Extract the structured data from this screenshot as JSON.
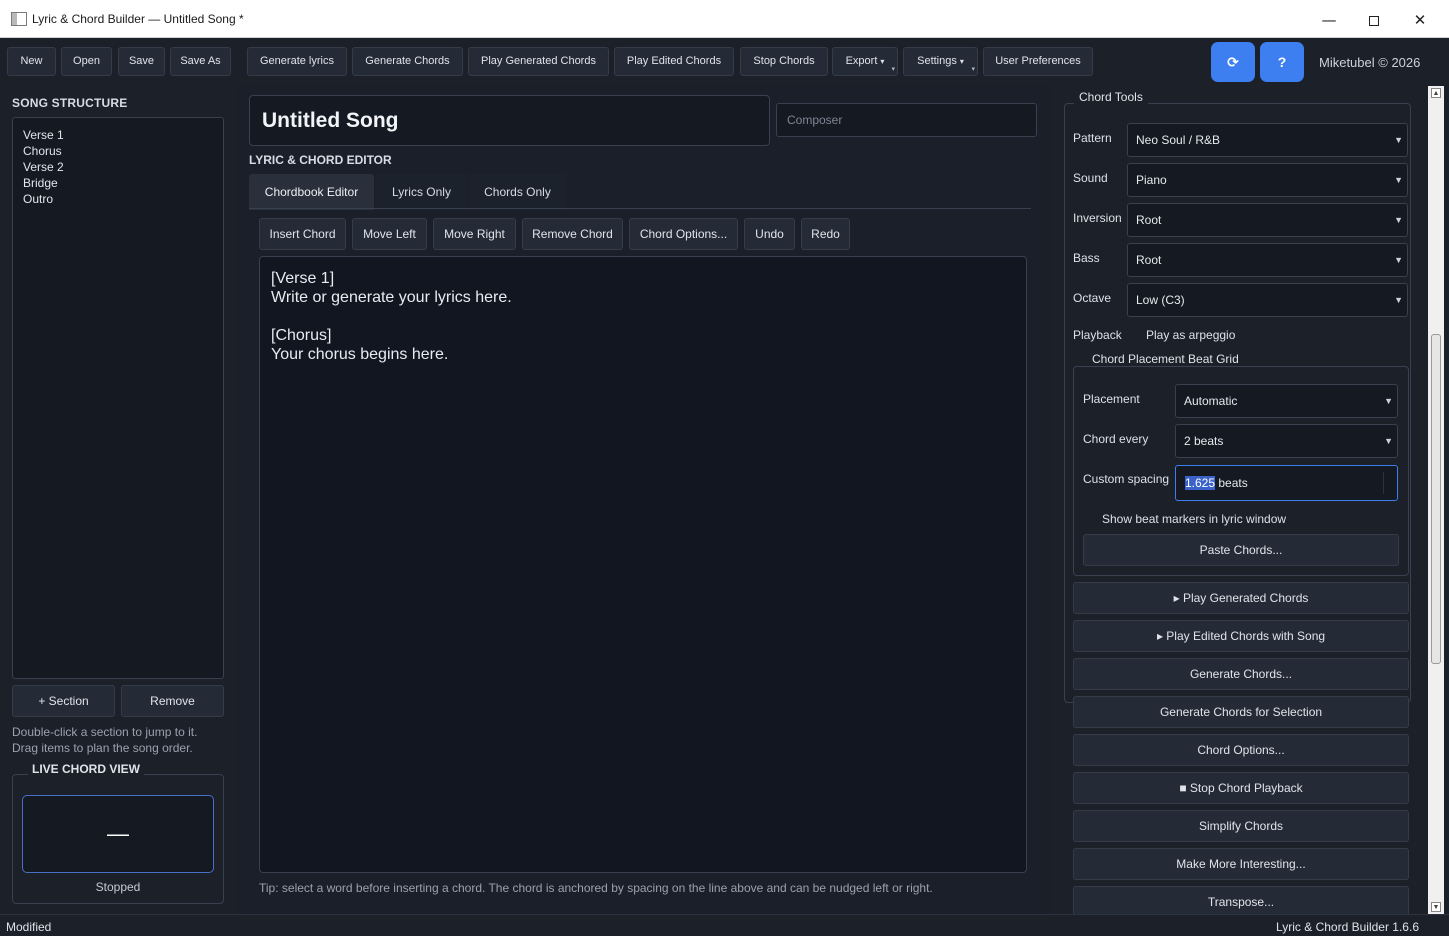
{
  "window": {
    "title": "Lyric & Chord Builder — Untitled Song *",
    "minimize": "—",
    "close": "✕"
  },
  "toolbar": {
    "new": "New",
    "open": "Open",
    "save": "Save",
    "save_as": "Save As",
    "generate_lyrics": "Generate lyrics",
    "generate_chords": "Generate Chords",
    "play_generated": "Play Generated Chords",
    "play_edited": "Play Edited Chords",
    "stop_chords": "Stop Chords",
    "export": "Export",
    "settings": "Settings",
    "user_prefs": "User Preferences",
    "refresh_icon": "⟳",
    "help_icon": "?",
    "copyright": "Miketubel © 2026"
  },
  "song_structure": {
    "label": "SONG STRUCTURE",
    "items": [
      "Verse 1",
      "Chorus",
      "Verse 2",
      "Bridge",
      "Outro"
    ],
    "add_section": "+ Section",
    "remove": "Remove",
    "hint_line1": "Double-click a section to jump to it.",
    "hint_line2": "Drag items to plan the song order."
  },
  "live_chord": {
    "label": "LIVE CHORD VIEW",
    "current": "—",
    "status": "Stopped"
  },
  "editor": {
    "song_title": "Untitled Song",
    "composer_placeholder": "Composer",
    "section_label": "LYRIC & CHORD EDITOR",
    "tabs": [
      "Chordbook Editor",
      "Lyrics Only",
      "Chords Only"
    ],
    "buttons": [
      "Insert Chord",
      "Move Left",
      "Move Right",
      "Remove Chord",
      "Chord Options...",
      "Undo",
      "Redo"
    ],
    "text": "[Verse 1]\nWrite or generate your lyrics here.\n\n[Chorus]\nYour chorus begins here.",
    "tip": "Tip: select a word before inserting a chord. The chord is anchored by spacing on the line above and can be nudged left or right."
  },
  "chord_tools": {
    "label": "Chord Tools",
    "pattern_label": "Pattern",
    "pattern_value": "Neo Soul / R&B",
    "sound_label": "Sound",
    "sound_value": "Piano",
    "inversion_label": "Inversion",
    "inversion_value": "Root",
    "bass_label": "Bass",
    "bass_value": "Root",
    "octave_label": "Octave",
    "octave_value": "Low (C3)",
    "playback_label": "Playback",
    "playback_value": "Play as arpeggio",
    "placement_group": "Chord Placement  Beat Grid",
    "placement_label": "Placement",
    "placement_value": "Automatic",
    "chord_every_label": "Chord every",
    "chord_every_value": "2 beats",
    "custom_spacing_label": "Custom spacing",
    "custom_spacing_number": "1.625",
    "custom_spacing_unit": " beats",
    "show_markers": "Show beat markers in lyric window",
    "paste_chords": "Paste Chords...",
    "actions": [
      "▸ Play Generated Chords",
      "▸ Play Edited Chords with Song",
      "Generate Chords...",
      "Generate Chords for Selection",
      "Chord Options...",
      "■ Stop Chord Playback",
      "Simplify Chords",
      "Make More Interesting...",
      "Transpose..."
    ]
  },
  "status": {
    "left": "Modified",
    "right": "Lyric & Chord Builder 1.6.6"
  }
}
